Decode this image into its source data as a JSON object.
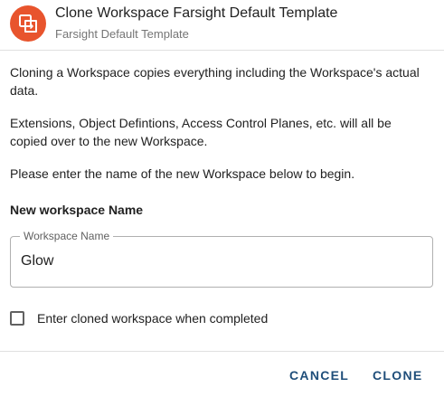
{
  "dialog": {
    "title": "Clone Workspace Farsight Default Template",
    "subtitle": "Farsight Default Template",
    "icon": "clone-icon",
    "accent_color": "#e8542d"
  },
  "body": {
    "paragraph_1": "Cloning a Workspace copies everything including the Workspace's actual data.",
    "paragraph_2": "Extensions, Object Defintions, Access Control Planes, etc. will all be copied over to the new Workspace.",
    "paragraph_3": "Please enter the name of the new Workspace below to begin."
  },
  "form": {
    "section_label": "New workspace Name",
    "name_field": {
      "legend": "Workspace Name",
      "value": "Glow"
    },
    "checkbox": {
      "label": "Enter cloned workspace when completed",
      "checked": false
    }
  },
  "actions": {
    "cancel_label": "CANCEL",
    "clone_label": "CLONE",
    "button_color": "#1f4e7a"
  }
}
